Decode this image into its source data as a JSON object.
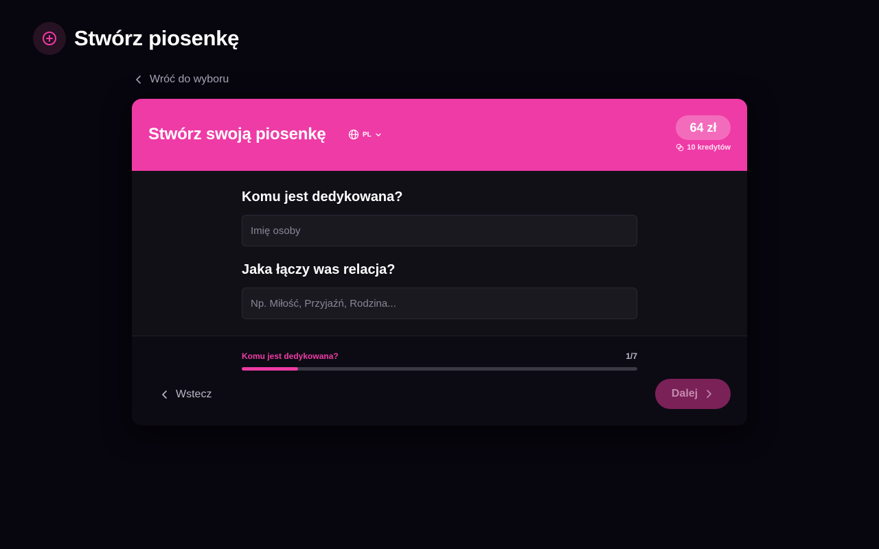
{
  "page": {
    "title": "Stwórz piosenkę",
    "header_icon": "plus-circle-icon",
    "back_link": "Wróć do wyboru"
  },
  "card": {
    "title": "Stwórz swoją piosenkę",
    "language": "PL",
    "price": "64 zł",
    "credits": "10 kredytów"
  },
  "form": {
    "question_1": "Komu jest dedykowana?",
    "input_1_placeholder": "Imię osoby",
    "input_1_value": "",
    "question_2": "Jaka łączy was relacja?",
    "input_2_placeholder": "Np. Miłość, Przyjaźń, Rodzina...",
    "input_2_value": ""
  },
  "progress": {
    "label": "Komu jest dedykowana?",
    "count": "1/7",
    "current": 1,
    "total": 7
  },
  "footer": {
    "prev_label": "Wstecz",
    "next_label": "Dalej"
  },
  "colors": {
    "accent": "#ef3ba6",
    "background": "#07050d",
    "card": "#111017",
    "next_button": "#7a2158"
  }
}
